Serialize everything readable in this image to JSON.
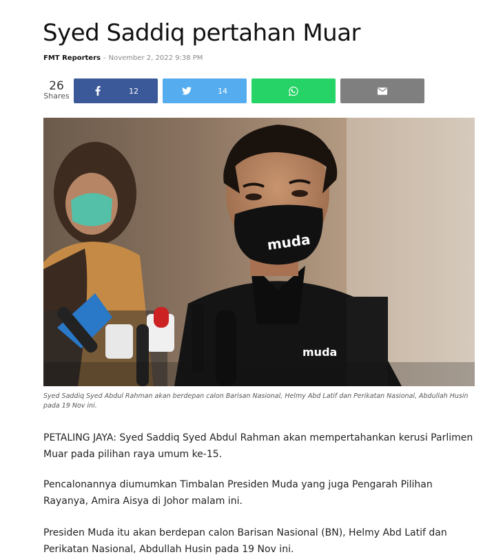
{
  "article": {
    "title": "Syed Saddiq pertahan Muar",
    "author": "FMT Reporters",
    "separator": "-",
    "date": "November 2, 2022 9:38 PM"
  },
  "share": {
    "count": "26",
    "label": "Shares",
    "facebook": {
      "icon": "facebook-icon",
      "count": "12",
      "color": "#3b5998"
    },
    "twitter": {
      "icon": "twitter-icon",
      "count": "14",
      "color": "#55acee"
    },
    "whatsapp": {
      "icon": "whatsapp-icon",
      "color": "#25d366"
    },
    "email": {
      "icon": "email-icon",
      "color": "#7f7f7f"
    }
  },
  "image": {
    "caption": "Syed Saddiq Syed Abdul Rahman akan berdepan calon Barisan Nasional, Helmy Abd Latif dan Perikatan Nasional, Abdullah Husin pada 19 Nov ini.",
    "mask_text": "muda",
    "shirt_text": "muda"
  },
  "body": {
    "p1": "PETALING JAYA: Syed Saddiq Syed Abdul Rahman akan mempertahankan kerusi Parlimen Muar pada pilihan raya umum ke-15.",
    "p2": "Pencalonannya diumumkan Timbalan Presiden Muda yang juga Pengarah Pilihan Rayanya, Amira Aisya di Johor malam ini.",
    "p3": "Presiden Muda itu akan berdepan calon Barisan Nasional (BN), Helmy Abd Latif dan Perikatan Nasional, Abdullah Husin pada 19 Nov ini."
  }
}
